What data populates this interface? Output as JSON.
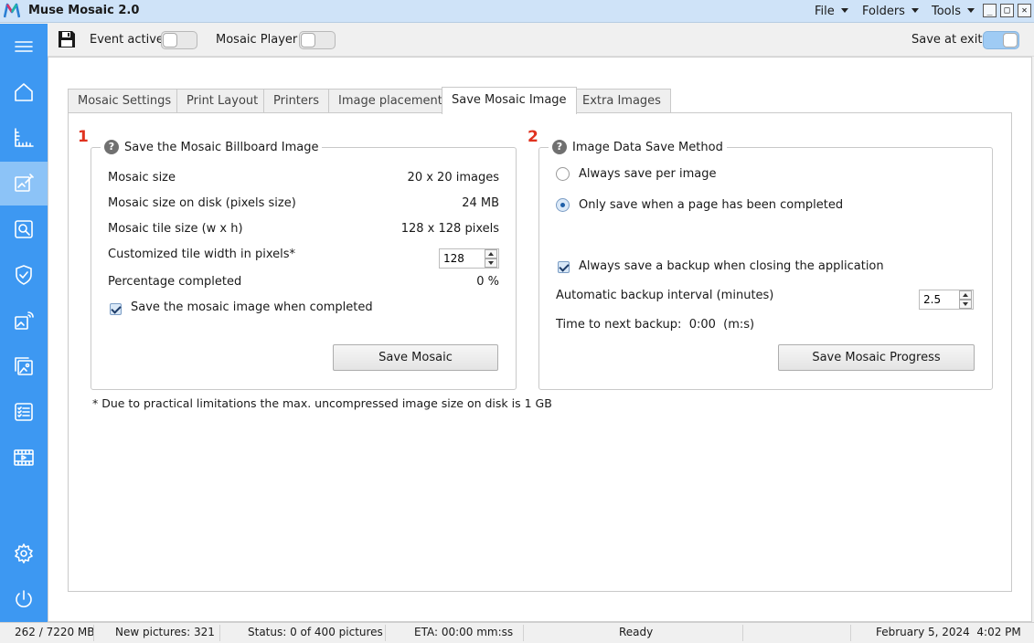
{
  "window": {
    "title": "Muse Mosaic 2.0",
    "menus": [
      "File",
      "Folders",
      "Tools"
    ],
    "controls": {
      "minimize": "_",
      "maximize": "□",
      "close": "✕"
    }
  },
  "sidebar": {
    "accent_color": "#3d98f2",
    "active_color": "#8cc3f7",
    "items": [
      {
        "icon": "hamburger-menu-icon"
      },
      {
        "icon": "home-icon"
      },
      {
        "icon": "ruler-icon"
      },
      {
        "icon": "edit-image-icon",
        "active": true
      },
      {
        "icon": "search-image-icon"
      },
      {
        "icon": "shield-check-icon"
      },
      {
        "icon": "cast-image-icon"
      },
      {
        "icon": "photos-icon"
      },
      {
        "icon": "checklist-icon"
      },
      {
        "icon": "video-icon"
      },
      {
        "icon": "gear-icon"
      },
      {
        "icon": "power-icon"
      }
    ]
  },
  "toolbar": {
    "save_icon": "floppy-disk-icon",
    "event_active_label": "Event active",
    "event_active_on": false,
    "mosaic_player_label": "Mosaic Player",
    "mosaic_player_on": false,
    "save_at_exit_label": "Save at exit",
    "save_at_exit_on": true
  },
  "tabs": [
    {
      "label": "Mosaic Settings"
    },
    {
      "label": "Print Layout"
    },
    {
      "label": "Printers"
    },
    {
      "label": "Image placement"
    },
    {
      "label": "Save Mosaic Image",
      "active": true
    },
    {
      "label": "Extra Images"
    }
  ],
  "section1": {
    "number": "1",
    "title": "Save the Mosaic Billboard Image",
    "rows": [
      {
        "label": "Mosaic size",
        "value": "20 x 20 images"
      },
      {
        "label": "Mosaic size on disk (pixels size)",
        "value": "24 MB"
      },
      {
        "label": "Mosaic tile size (w x h)",
        "value": "128 x 128 pixels"
      }
    ],
    "custom_tile_label": "Customized tile width in pixels*",
    "custom_tile_value": "128",
    "percentage_label": "Percentage completed",
    "percentage_value": "0 %",
    "save_when_completed_label": "Save the mosaic image when completed",
    "save_when_completed_checked": true,
    "save_button": "Save Mosaic"
  },
  "section2": {
    "number": "2",
    "title": "Image Data Save Method",
    "radio_always": "Always save per image",
    "radio_always_checked": false,
    "radio_page": "Only save when a page has been completed",
    "radio_page_checked": true,
    "backup_on_close_label": "Always save a backup when closing the application",
    "backup_on_close_checked": true,
    "backup_interval_label": "Automatic backup interval (minutes)",
    "backup_interval_value": "2.5",
    "next_backup_label": "Time to next backup:",
    "next_backup_value": "0:00",
    "next_backup_unit": "(m:s)",
    "save_button": "Save Mosaic Progress"
  },
  "footnote": "* Due to practical limitations the max. uncompressed image size on disk is 1 GB",
  "statusbar": {
    "memory": "262 / 7220 MB",
    "new_pictures": "New pictures: 321",
    "status": "Status: 0 of 400 pictures",
    "eta": "ETA: 00:00 mm:ss",
    "state": "Ready",
    "datetime": "February 5, 2024  4:02 PM"
  }
}
